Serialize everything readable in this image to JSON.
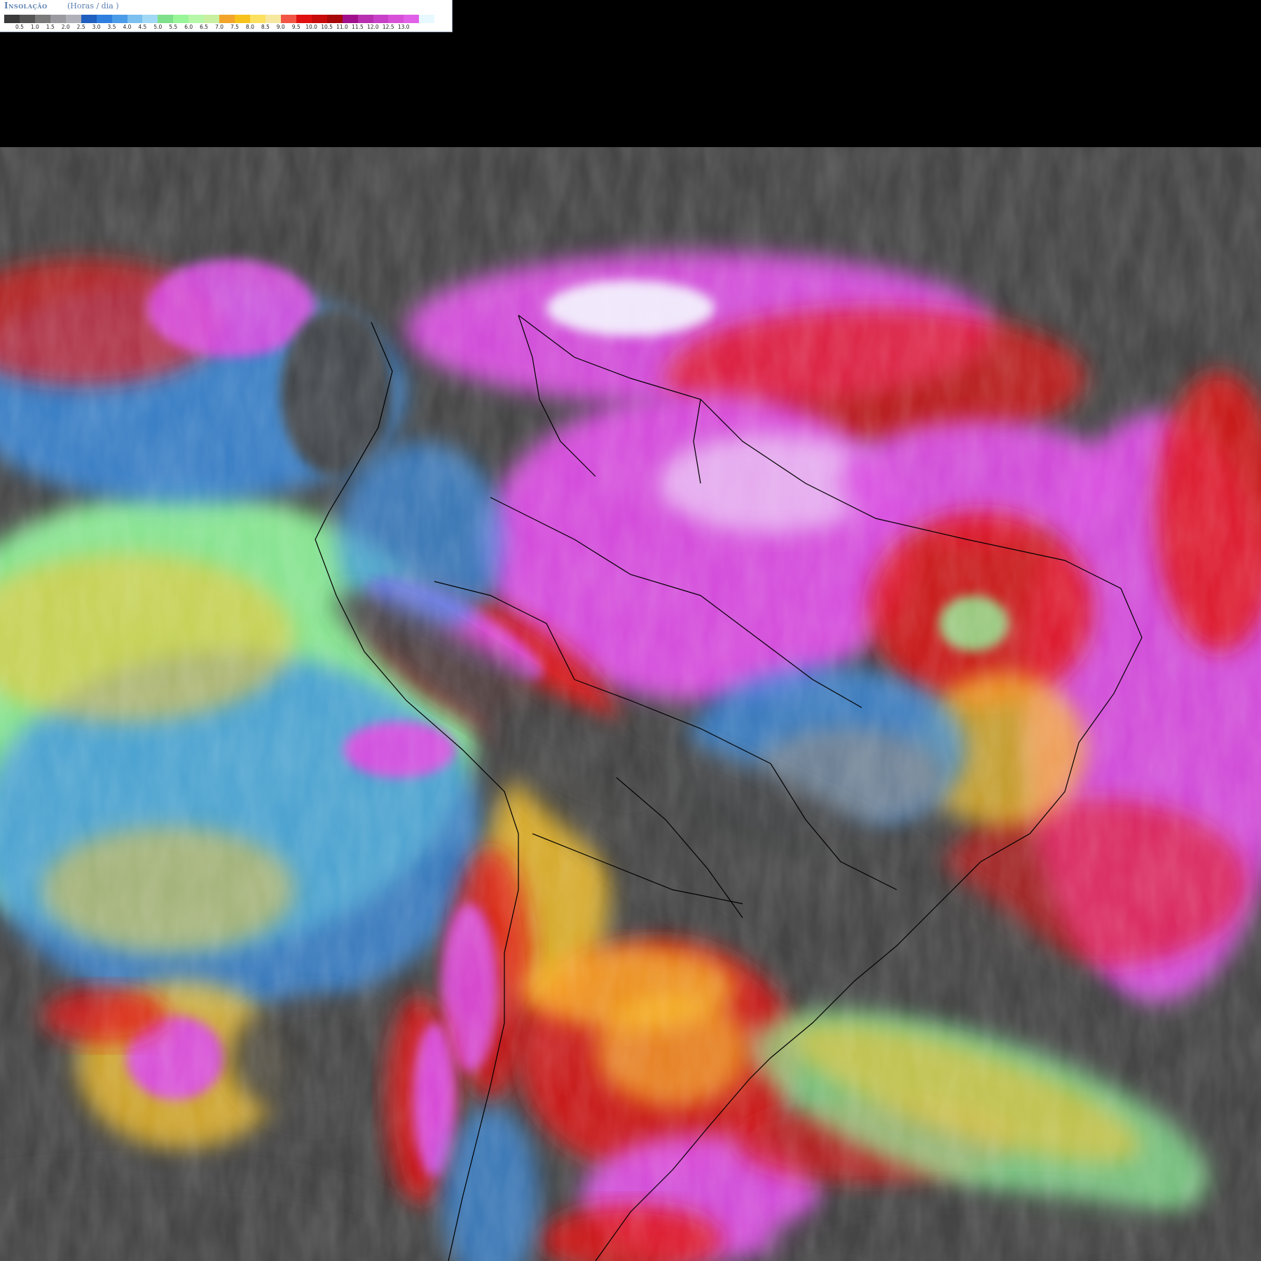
{
  "legend": {
    "title": "Insolação",
    "unit": "(Horas / dia )",
    "colors": [
      "#3a3a3a",
      "#555555",
      "#7a7a7a",
      "#9a9aa0",
      "#b0b0b8",
      "#1f5fbf",
      "#2f7fdf",
      "#4a9be8",
      "#7cc0f0",
      "#a0d8f5",
      "#7ee08a",
      "#98f598",
      "#b6f7a8",
      "#c8f0a0",
      "#f2a52a",
      "#f7c21b",
      "#fce060",
      "#f7e8a0",
      "#f25545",
      "#e01010",
      "#c80a0a",
      "#a80808",
      "#a0108c",
      "#b830b0",
      "#c840c8",
      "#d850d8",
      "#e060e8",
      "#e8f8ff",
      "#ffffff"
    ],
    "tick_labels": [
      "0.5",
      "1.0",
      "1.5",
      "2.0",
      "2.5",
      "3.0",
      "3.5",
      "4.0",
      "4.5",
      "5.0",
      "5.5",
      "6.0",
      "6.5",
      "7.0",
      "7.5",
      "8.0",
      "8.5",
      "9.0",
      "9.5",
      "10.0",
      "10.5",
      "11.0",
      "11.5",
      "12.0",
      "12.5",
      "13.0"
    ]
  },
  "map": {
    "palette": {
      "background": "#000000",
      "cloud_dark": "#454545",
      "cloud_gray": "#888888",
      "blue": "#3b8fe6",
      "green": "#8ff59a",
      "yellow": "#fbc52a",
      "red": "#e01414",
      "magenta": "#d94fe0",
      "white": "#f4f8ff",
      "border": "#000000"
    }
  }
}
